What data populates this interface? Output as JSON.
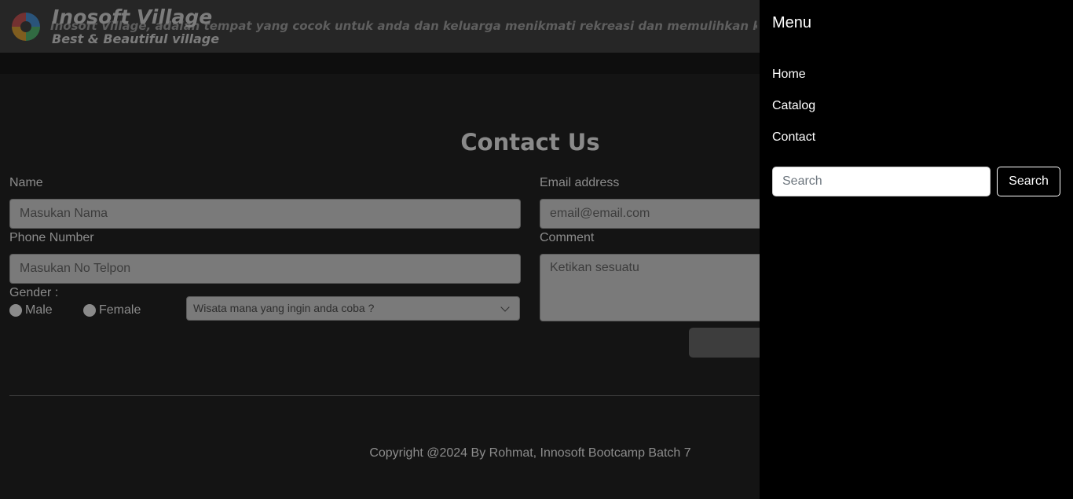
{
  "header": {
    "brand_title": "Inosoft Village",
    "brand_subtitle": "Best & Beautiful village",
    "marquee_text": "Inosoft Village, adalah tempat yang cocok untuk anda dan keluarga menikmati rekreasi dan memulihkan kesehatan mental dan fisik"
  },
  "contact": {
    "title": "Contact Us",
    "name_label": "Name",
    "name_placeholder": "Masukan Nama",
    "email_label": "Email address",
    "email_placeholder": "email@email.com",
    "phone_label": "Phone Number",
    "phone_placeholder": "Masukan No Telpon",
    "comment_label": "Comment",
    "comment_placeholder": "Ketikan sesuatu",
    "gender_label": "Gender :",
    "gender_options": [
      "Male",
      "Female"
    ],
    "select_value": "Wisata mana yang ingin anda coba ?"
  },
  "footer": {
    "copyright": "Copyright @2024 By Rohmat, Innosoft Bootcamp Batch 7"
  },
  "menu": {
    "title": "Menu",
    "items": [
      {
        "label": "Home"
      },
      {
        "label": "Catalog"
      },
      {
        "label": "Contact"
      }
    ],
    "search_placeholder": "Search",
    "search_button": "Search"
  },
  "colors": {
    "page_background": "#141414",
    "header_background": "#262626",
    "offcanvas_background": "#000000",
    "input_background": "#7a7a7a"
  },
  "icons": {
    "logo": "village-logo-icon",
    "select": "chevron-down-icon"
  }
}
